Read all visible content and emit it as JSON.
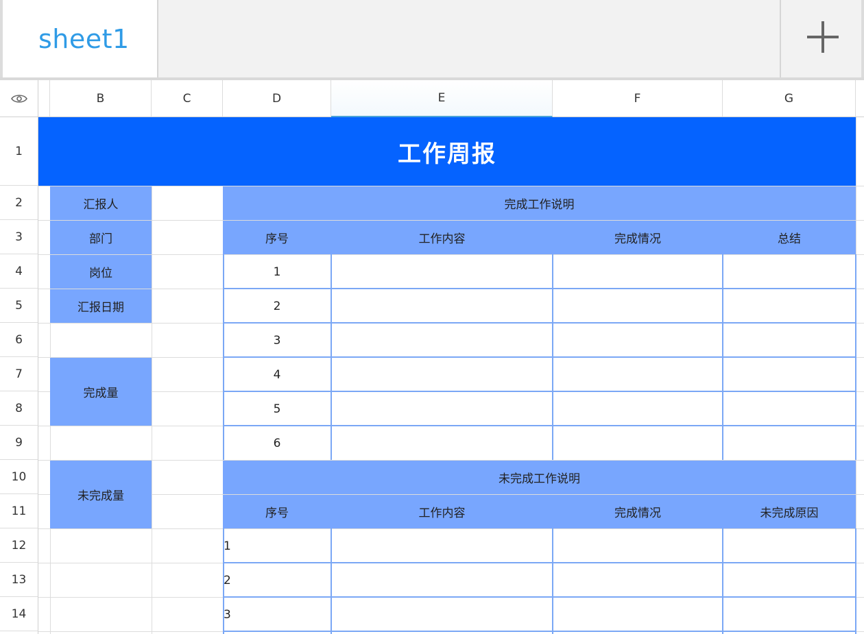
{
  "tabs": {
    "active_sheet": "sheet1"
  },
  "columns": [
    "B",
    "C",
    "D",
    "E",
    "F",
    "G"
  ],
  "rows": [
    "1",
    "2",
    "3",
    "4",
    "5",
    "6",
    "7",
    "8",
    "9",
    "10",
    "11",
    "12",
    "13",
    "14"
  ],
  "title": "工作周报",
  "left_labels": {
    "reporter": "汇报人",
    "department": "部门",
    "position": "岗位",
    "report_date": "汇报日期",
    "completed_qty": "完成量",
    "uncompleted_qty": "未完成量"
  },
  "completed_section": {
    "title": "完成工作说明",
    "headers": [
      "序号",
      "工作内容",
      "完成情况",
      "总结"
    ],
    "seq": [
      "1",
      "2",
      "3",
      "4",
      "5",
      "6"
    ]
  },
  "uncompleted_section": {
    "title": "未完成工作说明",
    "headers": [
      "序号",
      "工作内容",
      "完成情况",
      "未完成原因"
    ],
    "seq": [
      "1",
      "2",
      "3"
    ]
  },
  "colors": {
    "banner": "#0563ff",
    "label_fill": "#78a6fe",
    "tab_text": "#2f9be6"
  },
  "icons": {
    "visibility": "eye-icon",
    "add_sheet": "plus-icon"
  }
}
